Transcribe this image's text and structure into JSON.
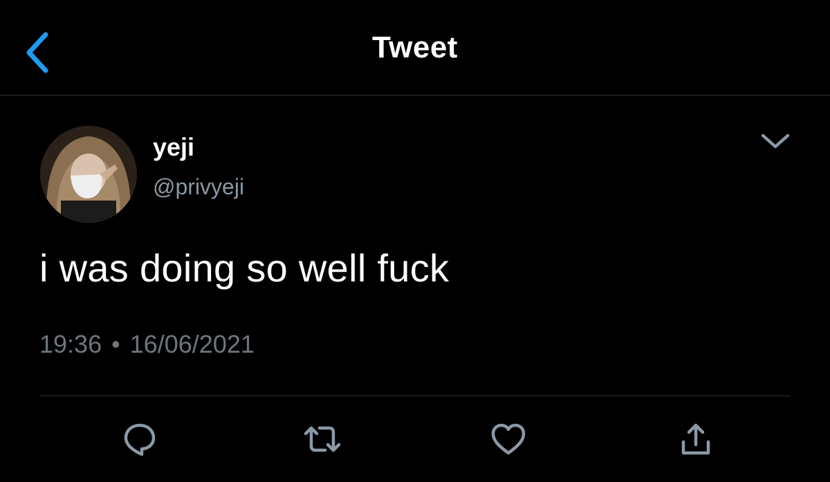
{
  "header": {
    "title": "Tweet",
    "back_icon": "chevron-left-icon",
    "back_color": "#1d9bf0"
  },
  "tweet": {
    "author": {
      "display_name": "yeji",
      "handle": "@privyeji"
    },
    "text": "i was doing so well fuck",
    "time": "19:36",
    "separator": "•",
    "date": "16/06/2021"
  },
  "actions": [
    {
      "name": "reply",
      "icon": "comment-icon"
    },
    {
      "name": "retweet",
      "icon": "retweet-icon"
    },
    {
      "name": "like",
      "icon": "heart-icon"
    },
    {
      "name": "share",
      "icon": "share-icon"
    }
  ],
  "colors": {
    "background": "#000000",
    "text": "#ffffff",
    "secondary": "#8b98a5",
    "icon": "#8b98a5"
  }
}
